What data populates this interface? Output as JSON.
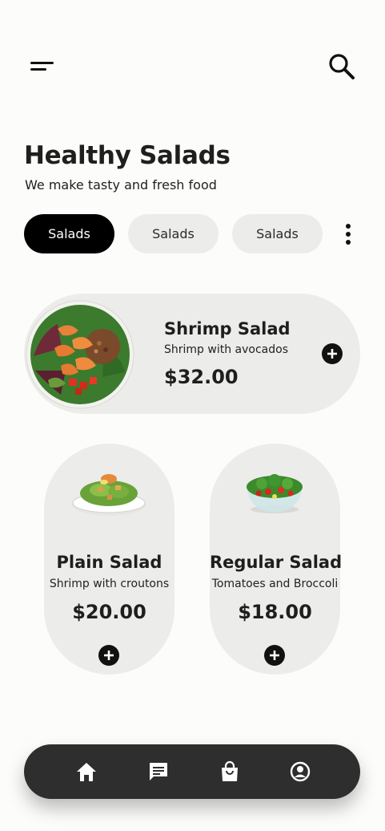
{
  "header": {
    "menu_icon": "menu-icon",
    "search_icon": "search-icon"
  },
  "title": "Healthy Salads",
  "subtitle": "We make tasty and fresh food",
  "categories": [
    {
      "label": "Salads",
      "active": true
    },
    {
      "label": "Salads",
      "active": false
    },
    {
      "label": "Salads",
      "active": false
    }
  ],
  "more_icon": "more-vertical-icon",
  "featured": {
    "name": "Shrimp Salad",
    "description": "Shrimp with avocados",
    "price": "$32.00"
  },
  "products": [
    {
      "name": "Plain Salad",
      "description": "Shrimp with croutons",
      "price": "$20.00"
    },
    {
      "name": "Regular Salad",
      "description": "Tomatoes and Broccoli",
      "price": "$18.00"
    }
  ],
  "bottom_nav": {
    "items": [
      "home-icon",
      "chat-icon",
      "shopping-bag-icon",
      "account-circle-icon"
    ]
  },
  "colors": {
    "background": "#fcfcfa",
    "card": "#ececea",
    "chip_active": "#000000",
    "nav": "#2e2e2e"
  }
}
